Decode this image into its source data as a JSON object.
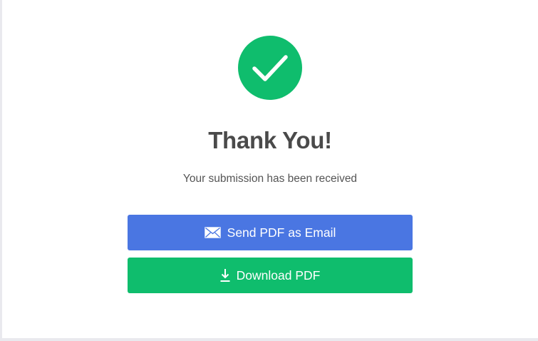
{
  "confirmation": {
    "title": "Thank You!",
    "message": "Your submission has been received"
  },
  "actions": {
    "email_label": "Send PDF as Email",
    "download_label": "Download PDF"
  },
  "icons": {
    "success": "check-circle-icon",
    "email": "envelope-icon",
    "download": "download-arrow-icon"
  },
  "colors": {
    "success_green": "#0fbd6d",
    "email_blue": "#4a76e2",
    "title_text": "#4a4a4a"
  }
}
